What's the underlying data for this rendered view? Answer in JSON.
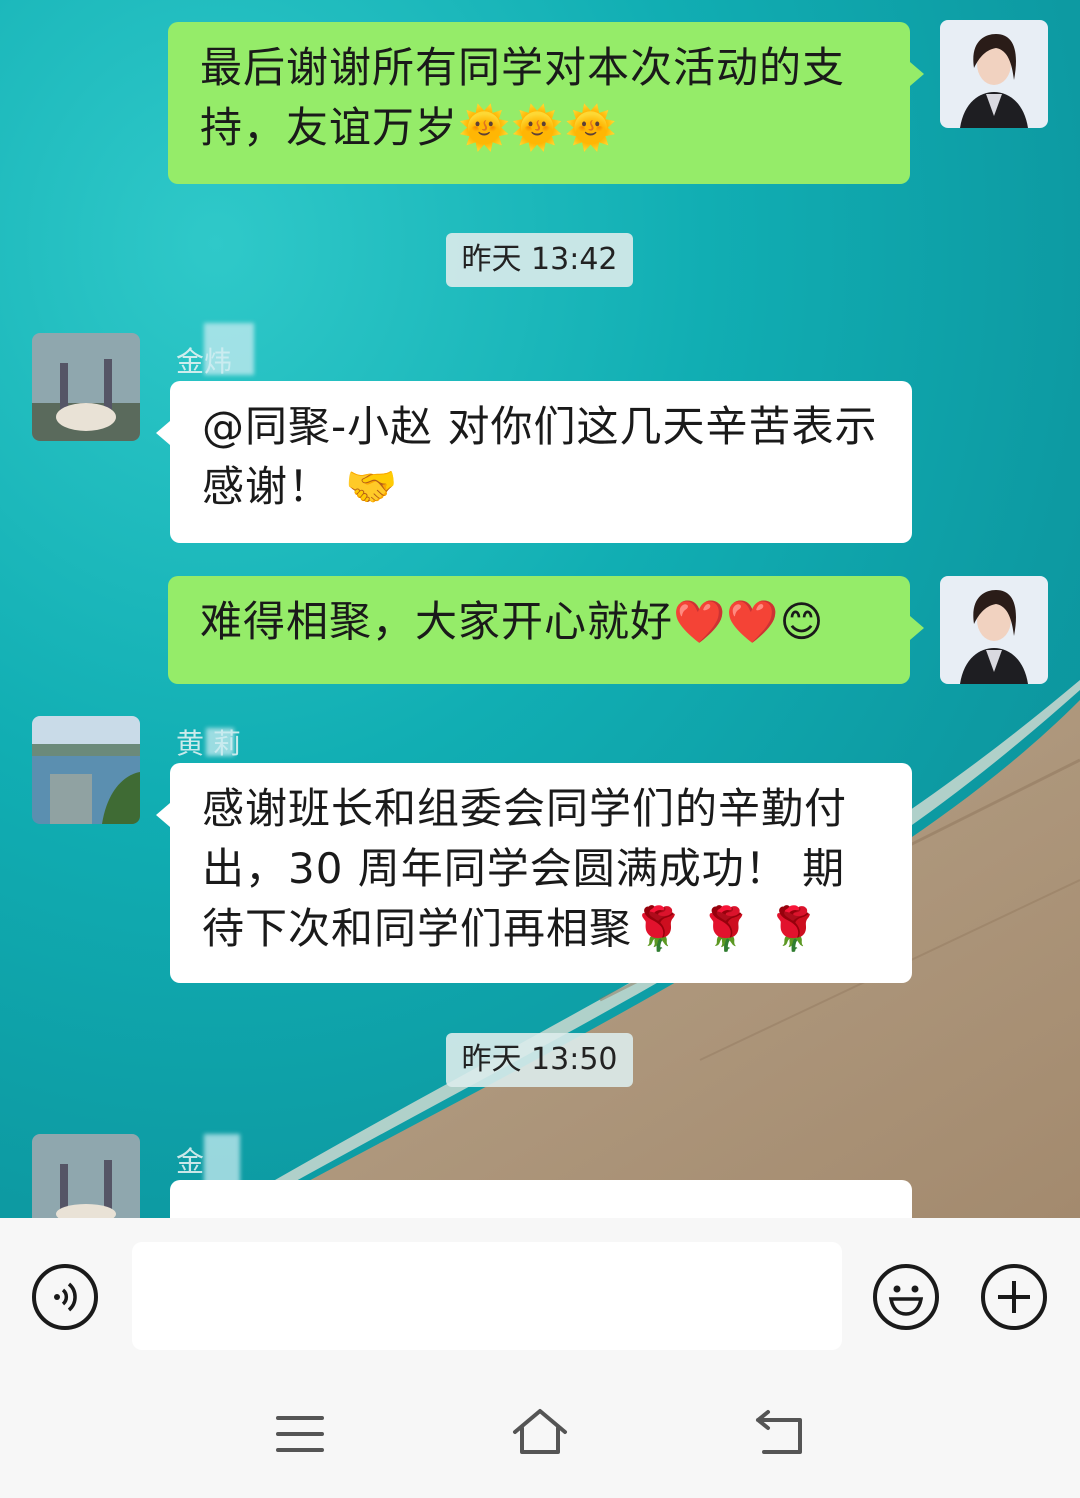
{
  "messages": [
    {
      "side": "right",
      "text": "最后谢谢所有同学对本次活动的支持，友谊万岁🌞🌞🌞"
    },
    {
      "timestamp": "昨天 13:42"
    },
    {
      "side": "left",
      "sender": "金炜",
      "text": "@同聚-小赵  对你们这几天辛苦表示感谢！ 🤝"
    },
    {
      "side": "right",
      "text": "难得相聚，大家开心就好❤️❤️😊"
    },
    {
      "side": "left",
      "sender": "黄 莉",
      "text": "感谢班长和组委会同学们的辛勤付出，30 周年同学会圆满成功！ 期待下次和同学们再相聚🌹 🌹 🌹"
    },
    {
      "timestamp": "昨天 13:50"
    },
    {
      "side": "left",
      "sender": "金",
      "text": ""
    }
  ],
  "colors": {
    "sent_bubble": "#95ec69",
    "received_bubble": "#ffffff",
    "input_bar": "#f7f7f7"
  },
  "icons": {
    "voice": "voice-icon",
    "emoji": "emoji-icon",
    "plus": "plus-icon",
    "menu": "menu-icon",
    "home": "home-icon",
    "back": "back-icon"
  }
}
